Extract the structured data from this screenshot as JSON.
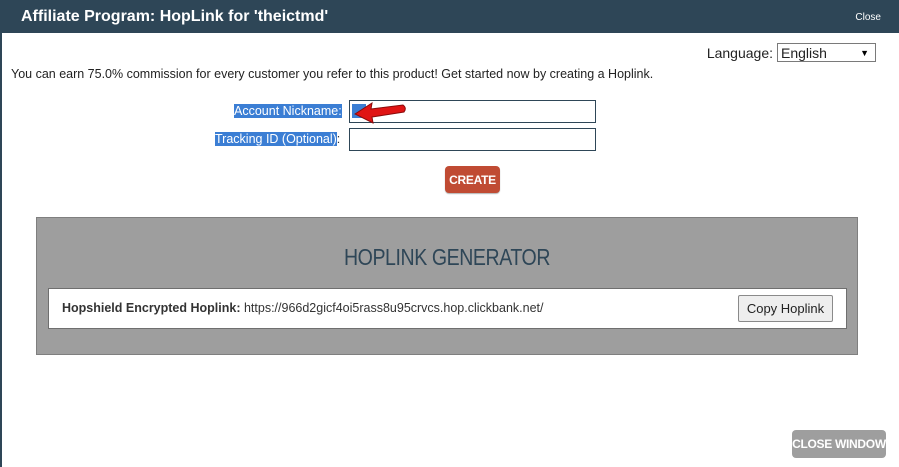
{
  "window": {
    "title": "Affiliate Program: HopLink for 'theictmd'",
    "close_label": "Close"
  },
  "language": {
    "label": "Language:",
    "selected": "English"
  },
  "intro_text": "You can earn 75.0% commission for every customer you refer to this product! Get started now by creating a Hoplink.",
  "form": {
    "nickname_label": "Account Nickname:",
    "tracking_label": "Tracking ID (Optional)",
    "tracking_suffix": ":",
    "tracking_value": "",
    "create_label": "CREATE"
  },
  "generator": {
    "title": "HOPLINK GENERATOR",
    "hoplink_label": "Hopshield Encrypted Hoplink:",
    "hoplink_url": "https://966d2gicf4oi5rass8u95crvcs.hop.clickbank.net/",
    "copy_label": "Copy Hoplink"
  },
  "footer": {
    "close_window_label": "CLOSE WINDOW"
  },
  "colors": {
    "titlebar": "#2e4657",
    "create_button": "#c04b33",
    "generator_panel": "#9e9e9e",
    "selection_highlight": "#3b7ed4",
    "annotation_arrow": "#e01414"
  }
}
